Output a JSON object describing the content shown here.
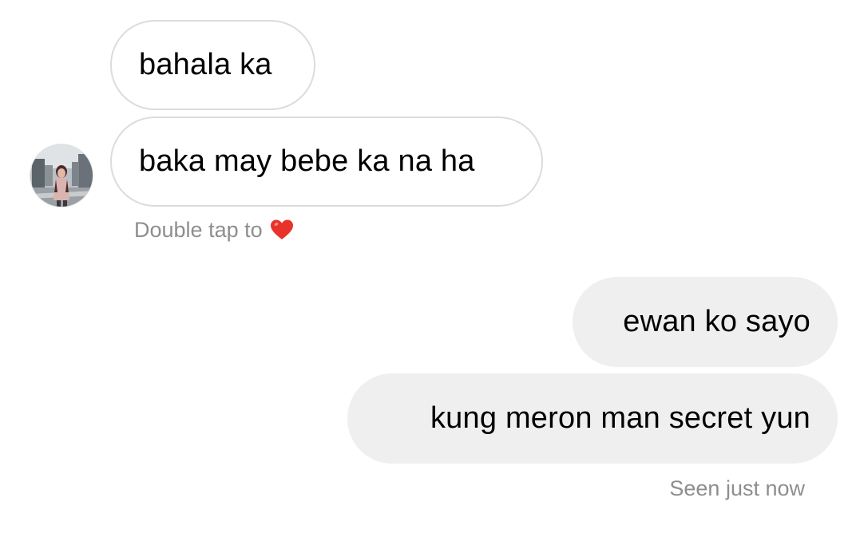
{
  "conversation": {
    "received_messages": [
      {
        "text": "bahala ka"
      },
      {
        "text": "baka may bebe ka na ha"
      }
    ],
    "double_tap_hint": "Double tap to",
    "hint_icon": "heart-icon",
    "sent_messages": [
      {
        "text": "ewan ko sayo"
      },
      {
        "text": "kung meron man secret yun"
      }
    ],
    "seen_status": "Seen just now"
  },
  "colors": {
    "background": "#ffffff",
    "received_bubble_border": "#dcdcdc",
    "sent_bubble_fill": "#efefef",
    "muted_text": "#8e8e8e",
    "heart": "#e8332a"
  }
}
